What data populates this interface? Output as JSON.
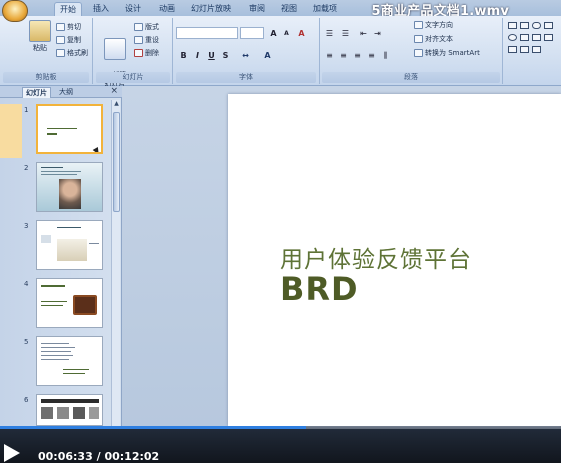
{
  "video": {
    "title": "5商业产品文档1.wmv",
    "current_time": "00:06:33",
    "separator": "/",
    "duration": "00:12:02",
    "progress": 0.545,
    "accent_color": "#2f7fe0"
  },
  "ribbon": {
    "tabs": [
      "开始",
      "插入",
      "设计",
      "动画",
      "幻灯片放映",
      "审阅",
      "视图",
      "加载项"
    ],
    "active_tab": "开始",
    "clipboard": {
      "paste": "粘贴",
      "cut": "剪切",
      "copy": "复制",
      "format_painter": "格式刷",
      "label": "剪贴板"
    },
    "slides": {
      "new_slide": "新建\n幻灯片",
      "layout": "版式",
      "reset": "重设",
      "delete": "删除",
      "label": "幻灯片"
    },
    "font": {
      "label": "字体",
      "bold": "B",
      "italic": "I",
      "underline": "U",
      "strike": "S",
      "grow": "A",
      "shrink": "A",
      "clear": "A"
    },
    "paragraph": {
      "label": "段落",
      "text_direction": "文字方向",
      "align_text": "对齐文本",
      "smartart": "转换为 SmartArt"
    }
  },
  "panel": {
    "tabs": [
      "幻灯片",
      "大纲"
    ],
    "active_tab": "幻灯片",
    "close": "×",
    "slides": [
      {
        "num": "1",
        "selected": true
      },
      {
        "num": "2",
        "selected": false
      },
      {
        "num": "3",
        "selected": false
      },
      {
        "num": "4",
        "selected": false
      },
      {
        "num": "5",
        "selected": false
      },
      {
        "num": "6",
        "selected": false
      }
    ]
  },
  "slide": {
    "title": "用户体验反馈平台",
    "subtitle": "BRD",
    "title_color": "#5e7336",
    "subtitle_color": "#4e5b26"
  }
}
